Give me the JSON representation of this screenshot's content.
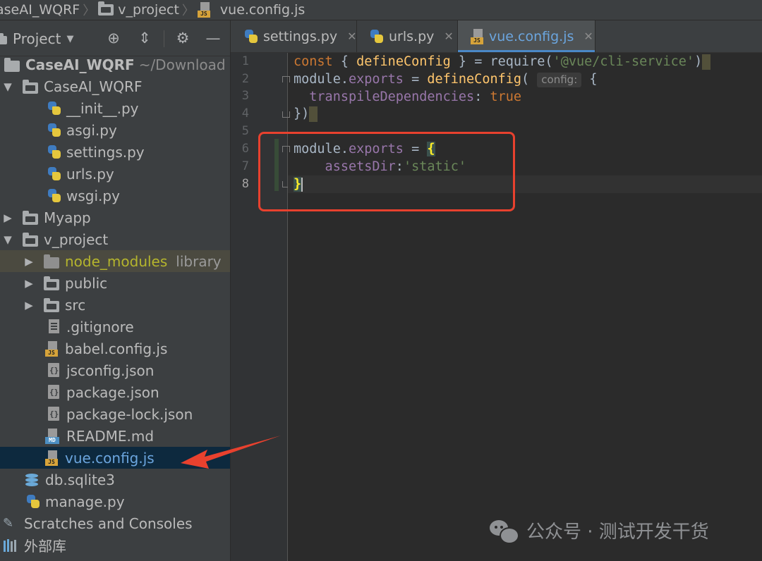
{
  "breadcrumb": {
    "items": [
      "aseAI_WQRF",
      "v_project",
      "vue.config.js"
    ]
  },
  "project_panel": {
    "title": "Project",
    "tree": [
      {
        "label": "CaseAI_WQRF",
        "hint": "~/Download",
        "type": "root-folder",
        "depth": 0,
        "arrow": ""
      },
      {
        "label": "CaseAI_WQRF",
        "type": "folder",
        "depth": 0,
        "arrow": "▼"
      },
      {
        "label": "__init__.py",
        "type": "py",
        "depth": 1
      },
      {
        "label": "asgi.py",
        "type": "py",
        "depth": 1
      },
      {
        "label": "settings.py",
        "type": "py",
        "depth": 1
      },
      {
        "label": "urls.py",
        "type": "py",
        "depth": 1
      },
      {
        "label": "wsgi.py",
        "type": "py",
        "depth": 1
      },
      {
        "label": "Myapp",
        "type": "folder",
        "depth": 0,
        "arrow": "▶"
      },
      {
        "label": "v_project",
        "type": "folder",
        "depth": 0,
        "arrow": "▼"
      },
      {
        "label": "node_modules",
        "hint": "library",
        "type": "folder-nm",
        "depth": 1,
        "arrow": "▶"
      },
      {
        "label": "public",
        "type": "folder",
        "depth": 1,
        "arrow": "▶"
      },
      {
        "label": "src",
        "type": "folder",
        "depth": 1,
        "arrow": "▶"
      },
      {
        "label": ".gitignore",
        "type": "txt",
        "depth": 1
      },
      {
        "label": "babel.config.js",
        "type": "js",
        "depth": 1
      },
      {
        "label": "jsconfig.json",
        "type": "json",
        "depth": 1
      },
      {
        "label": "package.json",
        "type": "json",
        "depth": 1
      },
      {
        "label": "package-lock.json",
        "type": "json",
        "depth": 1
      },
      {
        "label": "README.md",
        "type": "md",
        "depth": 1
      },
      {
        "label": "vue.config.js",
        "type": "js",
        "depth": 1,
        "selected": true
      },
      {
        "label": "db.sqlite3",
        "type": "db",
        "depth": 0
      },
      {
        "label": "manage.py",
        "type": "py",
        "depth": 0
      },
      {
        "label": "Scratches and Consoles",
        "type": "scratch",
        "depth": -1
      },
      {
        "label": "外部库",
        "type": "lib",
        "depth": -1
      }
    ]
  },
  "tabs": [
    {
      "label": "settings.py",
      "icon": "python-file-icon",
      "active": false
    },
    {
      "label": "urls.py",
      "icon": "python-file-icon",
      "active": false
    },
    {
      "label": "vue.config.js",
      "icon": "js-file-icon",
      "active": true
    }
  ],
  "editor": {
    "line_numbers": [
      "1",
      "2",
      "3",
      "4",
      "5",
      "6",
      "7",
      "8"
    ],
    "current_line": "8",
    "param_hint": "config:",
    "code": {
      "l1": {
        "a": "const",
        "b": " { ",
        "c": "defineConfig",
        "d": " } = require(",
        "e": "'@vue/cli-service'",
        "f": ")"
      },
      "l2": {
        "a": "module.",
        "b": "exports",
        "c": " = ",
        "d": "defineConfig",
        "e": "(",
        "f": "{"
      },
      "l3": {
        "a": "  transpileDependencies",
        "b": ": ",
        "c": "true"
      },
      "l4": {
        "a": "})"
      },
      "l6": {
        "a": "module.",
        "b": "exports",
        "c": " = ",
        "d": "{"
      },
      "l7": {
        "a": "    assetsDir",
        "b": ":",
        "c": "'static'"
      },
      "l8": {
        "a": "}"
      }
    }
  },
  "annotation": {
    "box_color": "#e8412e",
    "arrow_color": "#e8412e"
  },
  "watermark": {
    "text": "公众号 · 测试开发干货"
  },
  "colors": {
    "keyword": "#cc7832",
    "function": "#ffc66d",
    "string": "#6a8759",
    "property": "#9876aa",
    "selection": "#0d293e",
    "active_tab_underline": "#4a88c7"
  }
}
